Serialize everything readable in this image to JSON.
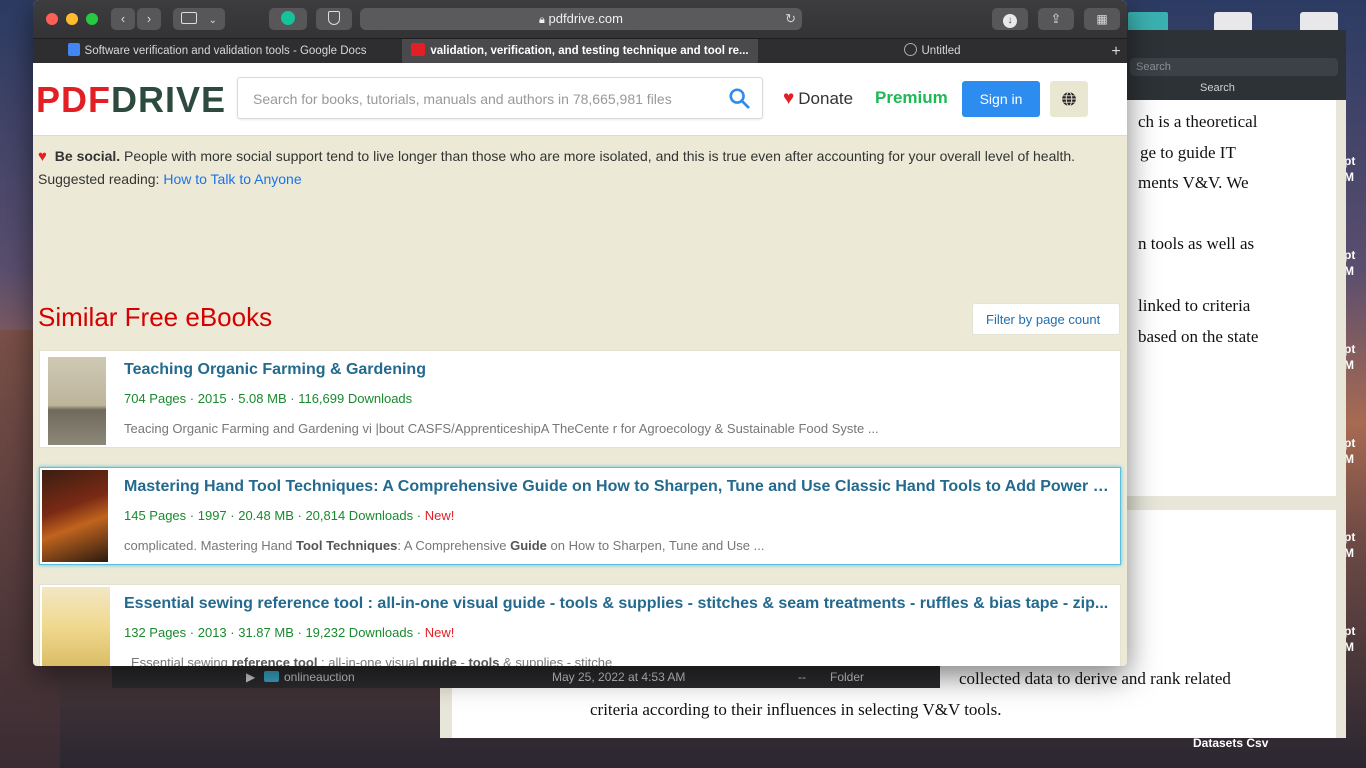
{
  "desktop": {
    "right_labels": [
      "pt",
      "M",
      "pt",
      "M",
      "pt",
      "M",
      "pt",
      "M",
      "pt",
      "M",
      "pt",
      "M"
    ],
    "bottom_label": "Datasets Csv",
    "finder_row": {
      "name": "onlineauction",
      "date": "May 25, 2022 at 4:53 AM",
      "size": "--",
      "kind": "Folder"
    }
  },
  "doc_window": {
    "search_placeholder": "Search",
    "search_label": "Search",
    "lines": [
      "ch is a theoretical",
      "ge  to  guide  IT",
      "ments  V&V.  We",
      "n tools as well as",
      "linked to criteria",
      "based on the state"
    ],
    "bottom_lines": [
      "collected data to derive and rank related",
      "criteria according to their influences in selecting V&V tools."
    ]
  },
  "browser": {
    "url": "pdfdrive.com",
    "tabs": [
      {
        "label": "Software verification and validation tools - Google Docs",
        "icon": "google-docs-icon",
        "active": false
      },
      {
        "label": "validation, verification, and testing technique and tool re...",
        "icon": "pdfdrive-icon",
        "active": true
      },
      {
        "label": "Untitled",
        "icon": "compass-icon",
        "active": false
      }
    ]
  },
  "site": {
    "logo_pdf": "PDF",
    "logo_drive": "DRIVE",
    "search_placeholder": "Search for books, tutorials, manuals and authors in 78,665,981 files",
    "donate": "Donate",
    "premium": "Premium",
    "signin": "Sign in",
    "social_bold": "Be social.",
    "social_text": " People with more social support tend to live longer than those who are more isolated, and this is true even after accounting for your overall level of health.",
    "suggested_label": "Suggested reading: ",
    "suggested_link": "How to Talk to Anyone",
    "similar_heading": "Similar Free eBooks",
    "filter_label": "Filter by page count"
  },
  "books": [
    {
      "title": "Teaching Organic Farming & Gardening",
      "pages": "704 Pages",
      "year": "2015",
      "size": "5.08 MB",
      "downloads": "116,699 Downloads",
      "new": "",
      "desc": "Teacing Organic Farming and Gardening vi |bout CASFS/ApprenticeshipA TheCente r for Agroecology & Sustainable Food Syste  ..."
    },
    {
      "title": "Mastering Hand Tool Techniques: A Comprehensive Guide on How to Sharpen, Tune and Use Classic Hand Tools to Add Power to...",
      "pages": "145 Pages",
      "year": "1997",
      "size": "20.48 MB",
      "downloads": "20,814 Downloads",
      "new": "New!",
      "desc_parts": [
        "complicated. Mastering Hand ",
        "Tool Techniques",
        ": A Comprehensive ",
        "Guide",
        " on How to Sharpen, Tune and Use  ..."
      ]
    },
    {
      "title": "Essential sewing reference tool : all-in-one visual guide - tools & supplies - stitches & seam treatments - ruffles & bias tape - zip...",
      "pages": "132 Pages",
      "year": "2013",
      "size": "31.87 MB",
      "downloads": "19,232 Downloads",
      "new": "New!",
      "desc_parts": [
        "Essential sewing ",
        "reference tool",
        " : all-in-one visual ",
        "guide",
        " - ",
        "tools",
        " & supplies - stitche"
      ]
    }
  ]
}
